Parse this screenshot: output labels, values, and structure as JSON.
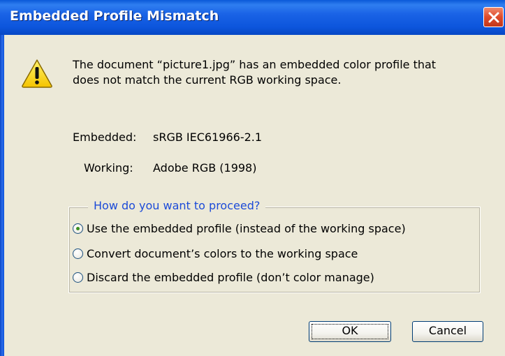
{
  "window": {
    "title": "Embedded Profile Mismatch",
    "title_bar_color": "#0c55dc",
    "close_icon": "close-icon"
  },
  "message": {
    "icon": "warning-icon",
    "line1": "The document “picture1.jpg” has an embedded color profile that",
    "line2": "does not match the current RGB working space."
  },
  "profiles": {
    "embedded_label": "Embedded:",
    "embedded_value": "sRGB IEC61966-2.1",
    "working_label": "Working:",
    "working_value": "Adobe RGB (1998)"
  },
  "options": {
    "legend": "How do you want to proceed?",
    "items": [
      {
        "label": "Use the embedded profile (instead of the working space)",
        "selected": true
      },
      {
        "label": "Convert document’s colors to the working space",
        "selected": false
      },
      {
        "label": "Discard the embedded profile (don’t color manage)",
        "selected": false
      }
    ]
  },
  "buttons": {
    "ok_label": "OK",
    "cancel_label": "Cancel"
  }
}
